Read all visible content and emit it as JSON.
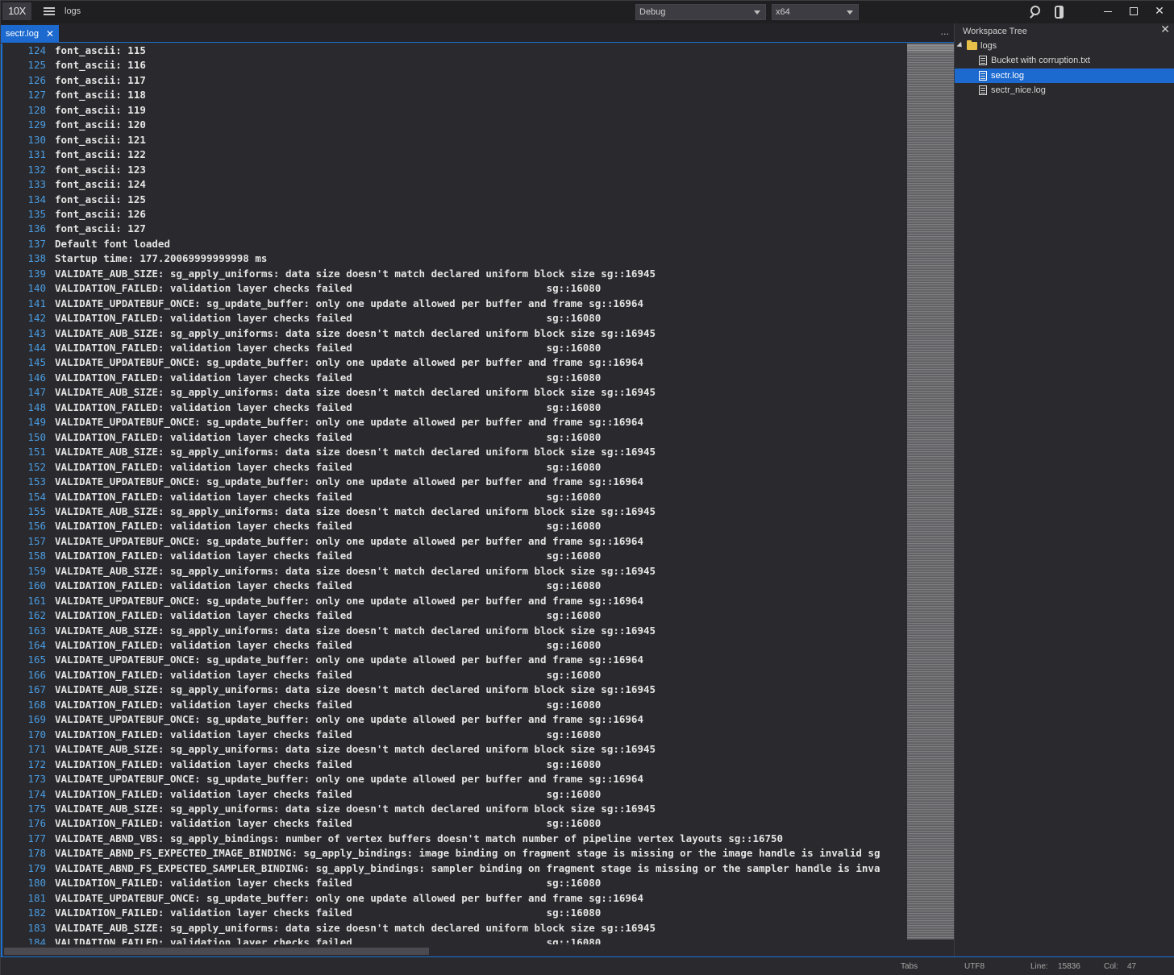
{
  "app": {
    "logo": "10X",
    "workspace": "logs"
  },
  "toolbar": {
    "config": "Debug",
    "platform": "x64"
  },
  "tabs": [
    {
      "label": "sectr.log",
      "close": "✕"
    }
  ],
  "tab_overflow": "...",
  "side_panel": {
    "title": "Workspace Tree",
    "close": "✕",
    "tree": [
      {
        "label": "logs",
        "type": "folder"
      },
      {
        "label": "Bucket with corruption.txt",
        "type": "file"
      },
      {
        "label": "sectr.log",
        "type": "file",
        "selected": true
      },
      {
        "label": "sectr_nice.log",
        "type": "file"
      }
    ]
  },
  "status": {
    "indent": "Tabs",
    "encoding": "UTF8",
    "line_label": "Line:",
    "line_value": "15836",
    "col_label": "Col:",
    "col_value": "47"
  },
  "editor": {
    "lines": [
      {
        "n": "124",
        "t": "font_ascii: 115"
      },
      {
        "n": "125",
        "t": "font_ascii: 116"
      },
      {
        "n": "126",
        "t": "font_ascii: 117"
      },
      {
        "n": "127",
        "t": "font_ascii: 118"
      },
      {
        "n": "128",
        "t": "font_ascii: 119"
      },
      {
        "n": "129",
        "t": "font_ascii: 120"
      },
      {
        "n": "130",
        "t": "font_ascii: 121"
      },
      {
        "n": "131",
        "t": "font_ascii: 122"
      },
      {
        "n": "132",
        "t": "font_ascii: 123"
      },
      {
        "n": "133",
        "t": "font_ascii: 124"
      },
      {
        "n": "134",
        "t": "font_ascii: 125"
      },
      {
        "n": "135",
        "t": "font_ascii: 126"
      },
      {
        "n": "136",
        "t": "font_ascii: 127"
      },
      {
        "n": "137",
        "t": "Default font loaded"
      },
      {
        "n": "138",
        "t": "Startup time: 177.20069999999998 ms"
      },
      {
        "n": "139",
        "t": "VALIDATE_AUB_SIZE: sg_apply_uniforms: data size doesn't match declared uniform block size sg::16945"
      },
      {
        "n": "140",
        "t": "VALIDATION_FAILED: validation layer checks failed                                sg::16080"
      },
      {
        "n": "141",
        "t": "VALIDATE_UPDATEBUF_ONCE: sg_update_buffer: only one update allowed per buffer and frame sg::16964"
      },
      {
        "n": "142",
        "t": "VALIDATION_FAILED: validation layer checks failed                                sg::16080"
      },
      {
        "n": "143",
        "t": "VALIDATE_AUB_SIZE: sg_apply_uniforms: data size doesn't match declared uniform block size sg::16945"
      },
      {
        "n": "144",
        "t": "VALIDATION_FAILED: validation layer checks failed                                sg::16080"
      },
      {
        "n": "145",
        "t": "VALIDATE_UPDATEBUF_ONCE: sg_update_buffer: only one update allowed per buffer and frame sg::16964"
      },
      {
        "n": "146",
        "t": "VALIDATION_FAILED: validation layer checks failed                                sg::16080"
      },
      {
        "n": "147",
        "t": "VALIDATE_AUB_SIZE: sg_apply_uniforms: data size doesn't match declared uniform block size sg::16945"
      },
      {
        "n": "148",
        "t": "VALIDATION_FAILED: validation layer checks failed                                sg::16080"
      },
      {
        "n": "149",
        "t": "VALIDATE_UPDATEBUF_ONCE: sg_update_buffer: only one update allowed per buffer and frame sg::16964"
      },
      {
        "n": "150",
        "t": "VALIDATION_FAILED: validation layer checks failed                                sg::16080"
      },
      {
        "n": "151",
        "t": "VALIDATE_AUB_SIZE: sg_apply_uniforms: data size doesn't match declared uniform block size sg::16945"
      },
      {
        "n": "152",
        "t": "VALIDATION_FAILED: validation layer checks failed                                sg::16080"
      },
      {
        "n": "153",
        "t": "VALIDATE_UPDATEBUF_ONCE: sg_update_buffer: only one update allowed per buffer and frame sg::16964"
      },
      {
        "n": "154",
        "t": "VALIDATION_FAILED: validation layer checks failed                                sg::16080"
      },
      {
        "n": "155",
        "t": "VALIDATE_AUB_SIZE: sg_apply_uniforms: data size doesn't match declared uniform block size sg::16945"
      },
      {
        "n": "156",
        "t": "VALIDATION_FAILED: validation layer checks failed                                sg::16080"
      },
      {
        "n": "157",
        "t": "VALIDATE_UPDATEBUF_ONCE: sg_update_buffer: only one update allowed per buffer and frame sg::16964"
      },
      {
        "n": "158",
        "t": "VALIDATION_FAILED: validation layer checks failed                                sg::16080"
      },
      {
        "n": "159",
        "t": "VALIDATE_AUB_SIZE: sg_apply_uniforms: data size doesn't match declared uniform block size sg::16945"
      },
      {
        "n": "160",
        "t": "VALIDATION_FAILED: validation layer checks failed                                sg::16080"
      },
      {
        "n": "161",
        "t": "VALIDATE_UPDATEBUF_ONCE: sg_update_buffer: only one update allowed per buffer and frame sg::16964"
      },
      {
        "n": "162",
        "t": "VALIDATION_FAILED: validation layer checks failed                                sg::16080"
      },
      {
        "n": "163",
        "t": "VALIDATE_AUB_SIZE: sg_apply_uniforms: data size doesn't match declared uniform block size sg::16945"
      },
      {
        "n": "164",
        "t": "VALIDATION_FAILED: validation layer checks failed                                sg::16080"
      },
      {
        "n": "165",
        "t": "VALIDATE_UPDATEBUF_ONCE: sg_update_buffer: only one update allowed per buffer and frame sg::16964"
      },
      {
        "n": "166",
        "t": "VALIDATION_FAILED: validation layer checks failed                                sg::16080"
      },
      {
        "n": "167",
        "t": "VALIDATE_AUB_SIZE: sg_apply_uniforms: data size doesn't match declared uniform block size sg::16945"
      },
      {
        "n": "168",
        "t": "VALIDATION_FAILED: validation layer checks failed                                sg::16080"
      },
      {
        "n": "169",
        "t": "VALIDATE_UPDATEBUF_ONCE: sg_update_buffer: only one update allowed per buffer and frame sg::16964"
      },
      {
        "n": "170",
        "t": "VALIDATION_FAILED: validation layer checks failed                                sg::16080"
      },
      {
        "n": "171",
        "t": "VALIDATE_AUB_SIZE: sg_apply_uniforms: data size doesn't match declared uniform block size sg::16945"
      },
      {
        "n": "172",
        "t": "VALIDATION_FAILED: validation layer checks failed                                sg::16080"
      },
      {
        "n": "173",
        "t": "VALIDATE_UPDATEBUF_ONCE: sg_update_buffer: only one update allowed per buffer and frame sg::16964"
      },
      {
        "n": "174",
        "t": "VALIDATION_FAILED: validation layer checks failed                                sg::16080"
      },
      {
        "n": "175",
        "t": "VALIDATE_AUB_SIZE: sg_apply_uniforms: data size doesn't match declared uniform block size sg::16945"
      },
      {
        "n": "176",
        "t": "VALIDATION_FAILED: validation layer checks failed                                sg::16080"
      },
      {
        "n": "177",
        "t": "VALIDATE_ABND_VBS: sg_apply_bindings: number of vertex buffers doesn't match number of pipeline vertex layouts sg::16750"
      },
      {
        "n": "178",
        "t": "VALIDATE_ABND_FS_EXPECTED_IMAGE_BINDING: sg_apply_bindings: image binding on fragment stage is missing or the image handle is invalid sg"
      },
      {
        "n": "179",
        "t": "VALIDATE_ABND_FS_EXPECTED_SAMPLER_BINDING: sg_apply_bindings: sampler binding on fragment stage is missing or the sampler handle is inva"
      },
      {
        "n": "180",
        "t": "VALIDATION_FAILED: validation layer checks failed                                sg::16080"
      },
      {
        "n": "181",
        "t": "VALIDATE_UPDATEBUF_ONCE: sg_update_buffer: only one update allowed per buffer and frame sg::16964"
      },
      {
        "n": "182",
        "t": "VALIDATION_FAILED: validation layer checks failed                                sg::16080"
      },
      {
        "n": "183",
        "t": "VALIDATE_AUB_SIZE: sg_apply_uniforms: data size doesn't match declared uniform block size sg::16945"
      },
      {
        "n": "184",
        "t": "VALIDATION_FAILED: validation layer checks failed                                sg::16080"
      }
    ]
  }
}
